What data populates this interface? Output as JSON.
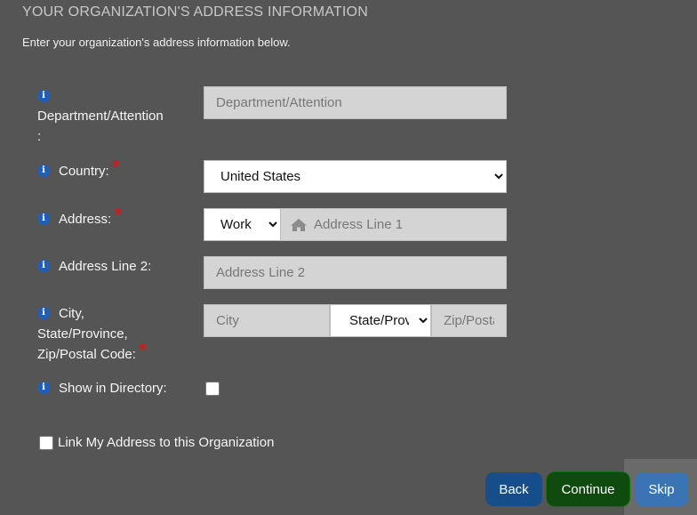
{
  "header": {
    "title": "YOUR ORGANIZATION'S ADDRESS INFORMATION",
    "subtitle": "Enter your organization's address information below."
  },
  "form": {
    "department": {
      "label_line1": "Department/Attention",
      "label_line2": ":",
      "placeholder": "Department/Attention"
    },
    "country": {
      "label": "Country:",
      "required": "*",
      "selected": "United States"
    },
    "address": {
      "label": "Address:",
      "required": "*",
      "type_selected": "Work",
      "placeholder": "Address Line 1",
      "icon": "home-icon"
    },
    "address2": {
      "label": "Address Line 2:",
      "placeholder": "Address Line 2"
    },
    "city_state_zip": {
      "label_line1": "City,",
      "label_line2": "State/Province,",
      "label_line3": "Zip/Postal Code:",
      "required": "*",
      "city_placeholder": "City",
      "state_selected": "State/Province",
      "zip_placeholder": "Zip/Postal Code"
    },
    "show_in_directory": {
      "label": "Show in Directory:",
      "checked": false
    },
    "link_address": {
      "label": "Link My Address to this Organization",
      "checked": false
    }
  },
  "buttons": {
    "back": "Back",
    "continue": "Continue",
    "skip": "Skip"
  },
  "icons": {
    "info": "i"
  },
  "colors": {
    "background": "#555555",
    "info_icon": "#1f5fb8",
    "required": "#d11a1a",
    "back_button": "#154e8a",
    "continue_button": "#0f4a0f",
    "skip_button": "#3a74b4"
  }
}
